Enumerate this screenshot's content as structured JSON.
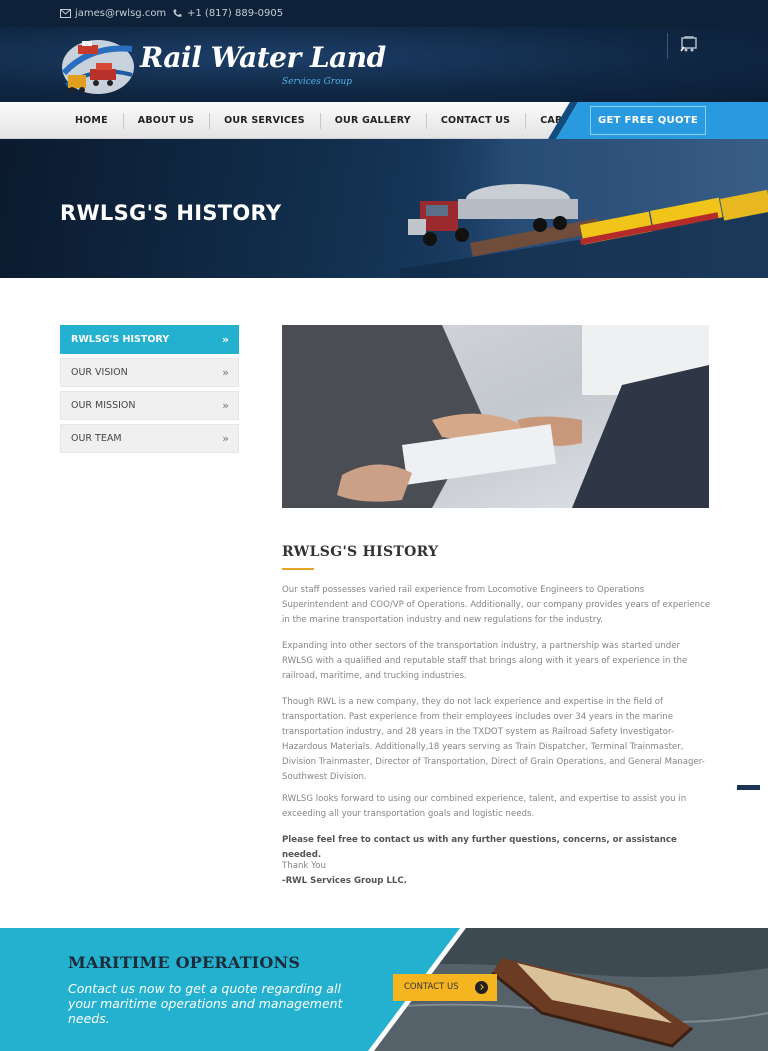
{
  "topbar": {
    "email": "james@rwlsg.com",
    "phone": "+1 (817) 889-0905"
  },
  "brand": {
    "title": "Rail Water Land",
    "subtitle": "Services Group"
  },
  "nav": {
    "items": [
      "HOME",
      "ABOUT US",
      "OUR SERVICES",
      "OUR GALLERY",
      "CONTACT US",
      "CAREERS"
    ],
    "cta": "GET FREE QUOTE"
  },
  "hero": {
    "title": "RWLSG'S HISTORY"
  },
  "sidebar": {
    "items": [
      "RWLSG'S HISTORY",
      "OUR VISION",
      "OUR MISSION",
      "OUR TEAM"
    ],
    "chevron": "»"
  },
  "main": {
    "title": "RWLSG'S HISTORY",
    "paragraphs": [
      "Our staff possesses varied rail experience from Locomotive Engineers to Operations Superintendent and COO/VP of Operations. Additionally, our company provides years of experience in the marine transportation industry and new regulations for the industry.",
      "Expanding into other sectors of the transportation industry, a partnership was started under RWLSG with a qualified and reputable staff that brings along with it years of experience in the railroad, maritime, and trucking industries.",
      "Though RWL is a new company, they do not lack experience and expertise in the field of transportation. Past experience from their employees includes over 34 years in the marine transportation industry, and 28 years in the TXDOT system as Railroad Safety Investigator-Hazardous Materials. Additionally,18 years serving as Train Dispatcher, Terminal Trainmaster, Division Trainmaster, Director of Transportation, Direct of Grain Operations, and General Manager-Southwest Division.",
      "RWLSG looks forward to using our combined experience, talent, and expertise to assist you in exceeding all your transportation goals and logistic needs."
    ],
    "bold_note": "Please feel free to contact us with any further questions, concerns, or assistance needed.",
    "closing": "Thank You",
    "signature": "-RWL Services Group LLC."
  },
  "cta": {
    "title": "MARITIME OPERATIONS",
    "text": "Contact us now to get a quote regarding all your maritime operations and management needs.",
    "button": "CONTACT US"
  },
  "colors": {
    "accent_cyan": "#23b1cf",
    "accent_blue": "#2a9ae0",
    "gold": "#f5b521",
    "header_navy": "#102845"
  },
  "icons": {
    "email": "envelope-icon",
    "phone": "phone-icon",
    "cart": "cart-icon",
    "cta_arrow": "arrow-right-icon"
  }
}
